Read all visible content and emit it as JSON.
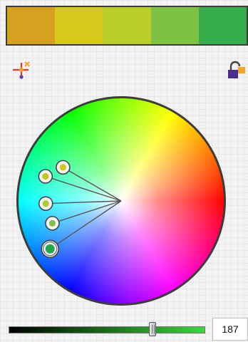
{
  "palette": {
    "swatches": [
      "#d6a11f",
      "#d8c71c",
      "#b8cf28",
      "#7ec143",
      "#35ad4b"
    ]
  },
  "harmony_icon": {
    "name": "harmony-rule-icon",
    "colors": [
      "#e63b2e",
      "#f0a030",
      "#5a3ea0"
    ]
  },
  "lock_icon": {
    "name": "lock-icon",
    "colors": [
      "#f5a623",
      "#4b2d8f"
    ]
  },
  "wheel": {
    "selected_hue_deg": 124,
    "markers": [
      {
        "hue": 60,
        "sat": 0.65,
        "fill": "#d6c41a"
      },
      {
        "hue": 72,
        "sat": 0.77,
        "fill": "#c9c41c"
      },
      {
        "hue": 92,
        "sat": 0.73,
        "fill": "#b6c52c"
      },
      {
        "hue": 108,
        "sat": 0.7,
        "fill": "#80c04a"
      },
      {
        "hue": 124,
        "sat": 0.83,
        "fill": "#22a84a",
        "primary": true
      }
    ]
  },
  "brightness": {
    "value": "187",
    "max": 255,
    "gradient_start": "#000000",
    "gradient_end": "#3ad63a"
  }
}
